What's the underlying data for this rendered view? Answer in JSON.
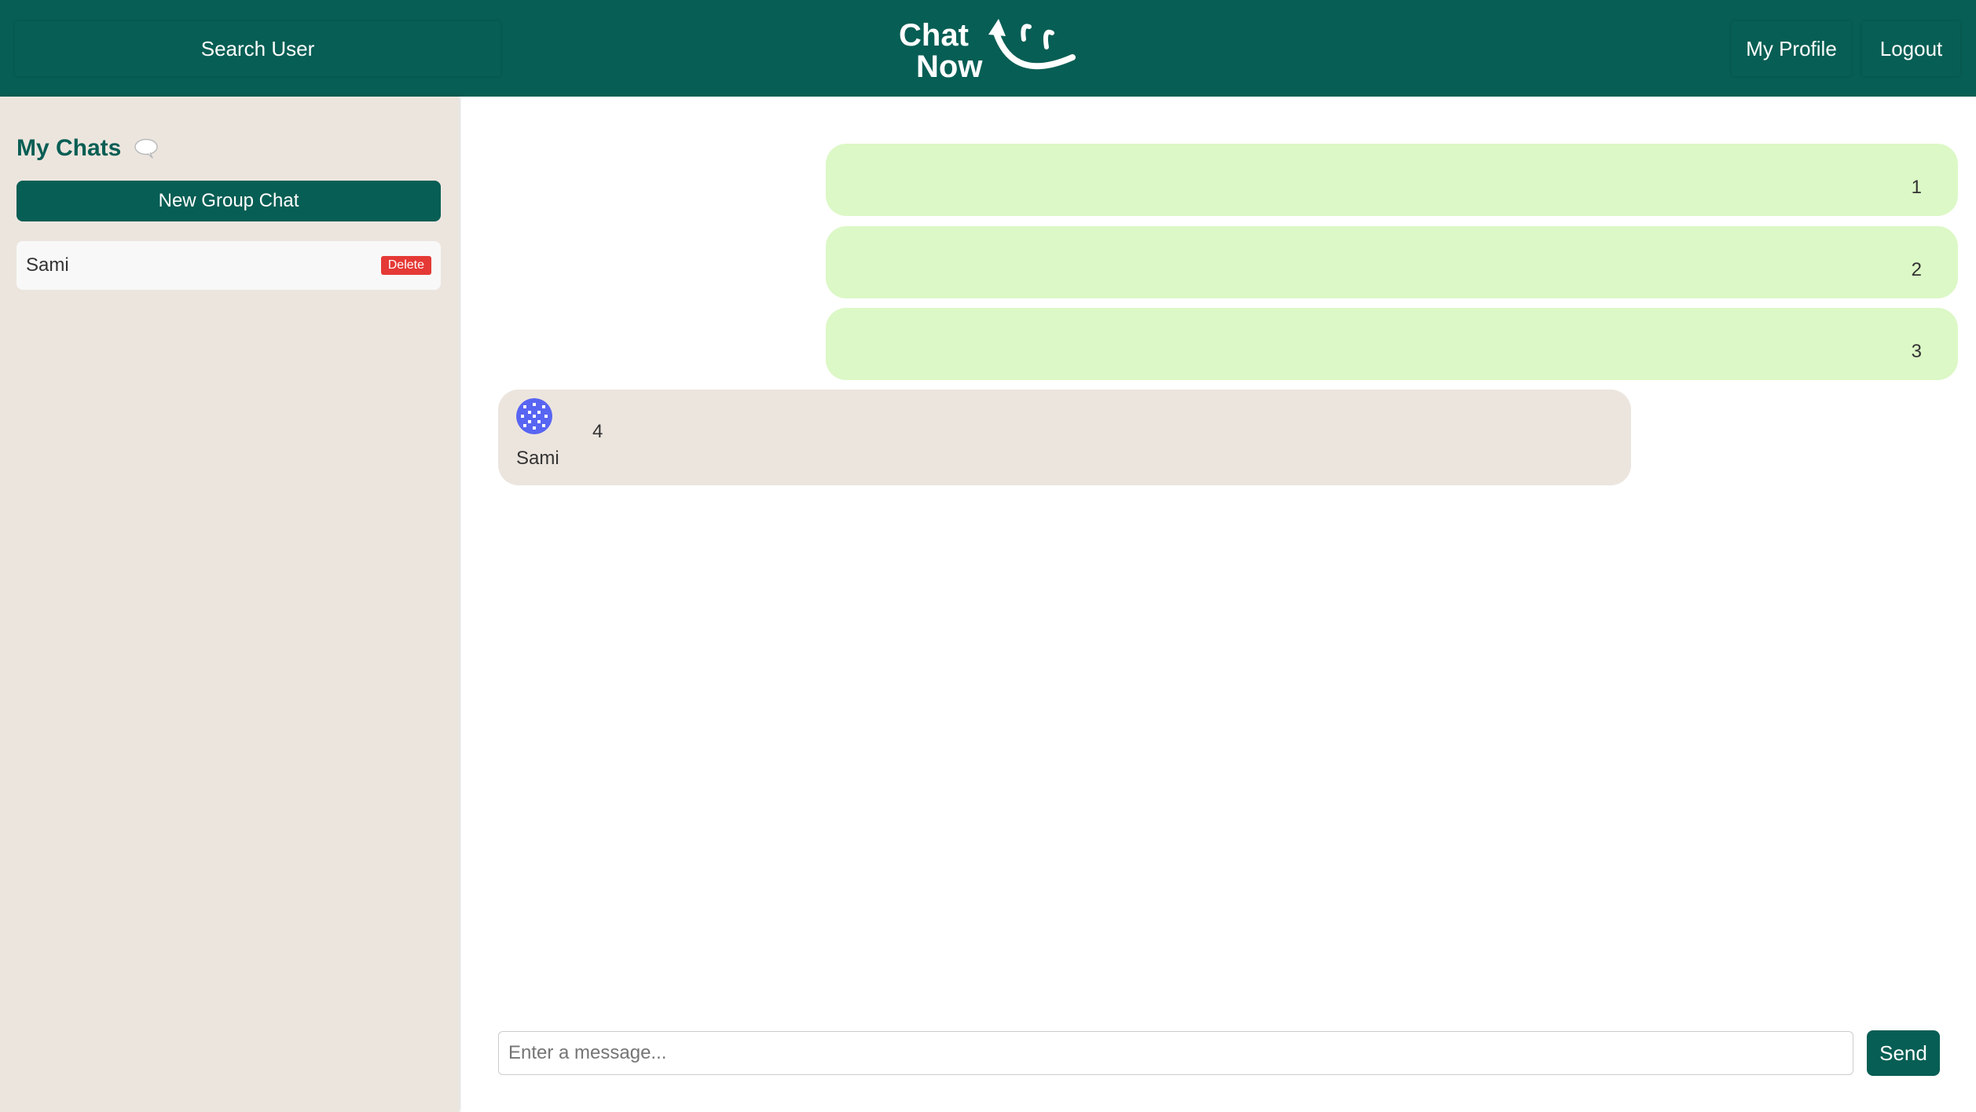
{
  "colors": {
    "brand": "#075e54",
    "sidebar_bg": "#ece5de",
    "own_bubble": "#dcf8c6",
    "other_bubble": "#ece5de",
    "delete": "#e53935"
  },
  "header": {
    "search_label": "Search User",
    "logo_line1": "Chat",
    "logo_line2": "Now",
    "profile_label": "My Profile",
    "logout_label": "Logout"
  },
  "sidebar": {
    "title": "My Chats",
    "title_icon": "speech-bubble-icon",
    "new_group_label": "New Group Chat",
    "chats": [
      {
        "name": "Sami",
        "delete_label": "Delete"
      }
    ]
  },
  "messages": [
    {
      "from": "me",
      "text": "1"
    },
    {
      "from": "me",
      "text": "2"
    },
    {
      "from": "me",
      "text": "3"
    },
    {
      "from": "other",
      "sender": "Sami",
      "avatar_icon": "user-avatar-icon",
      "text": "4"
    }
  ],
  "composer": {
    "placeholder": "Enter a message...",
    "value": "",
    "send_label": "Send"
  }
}
